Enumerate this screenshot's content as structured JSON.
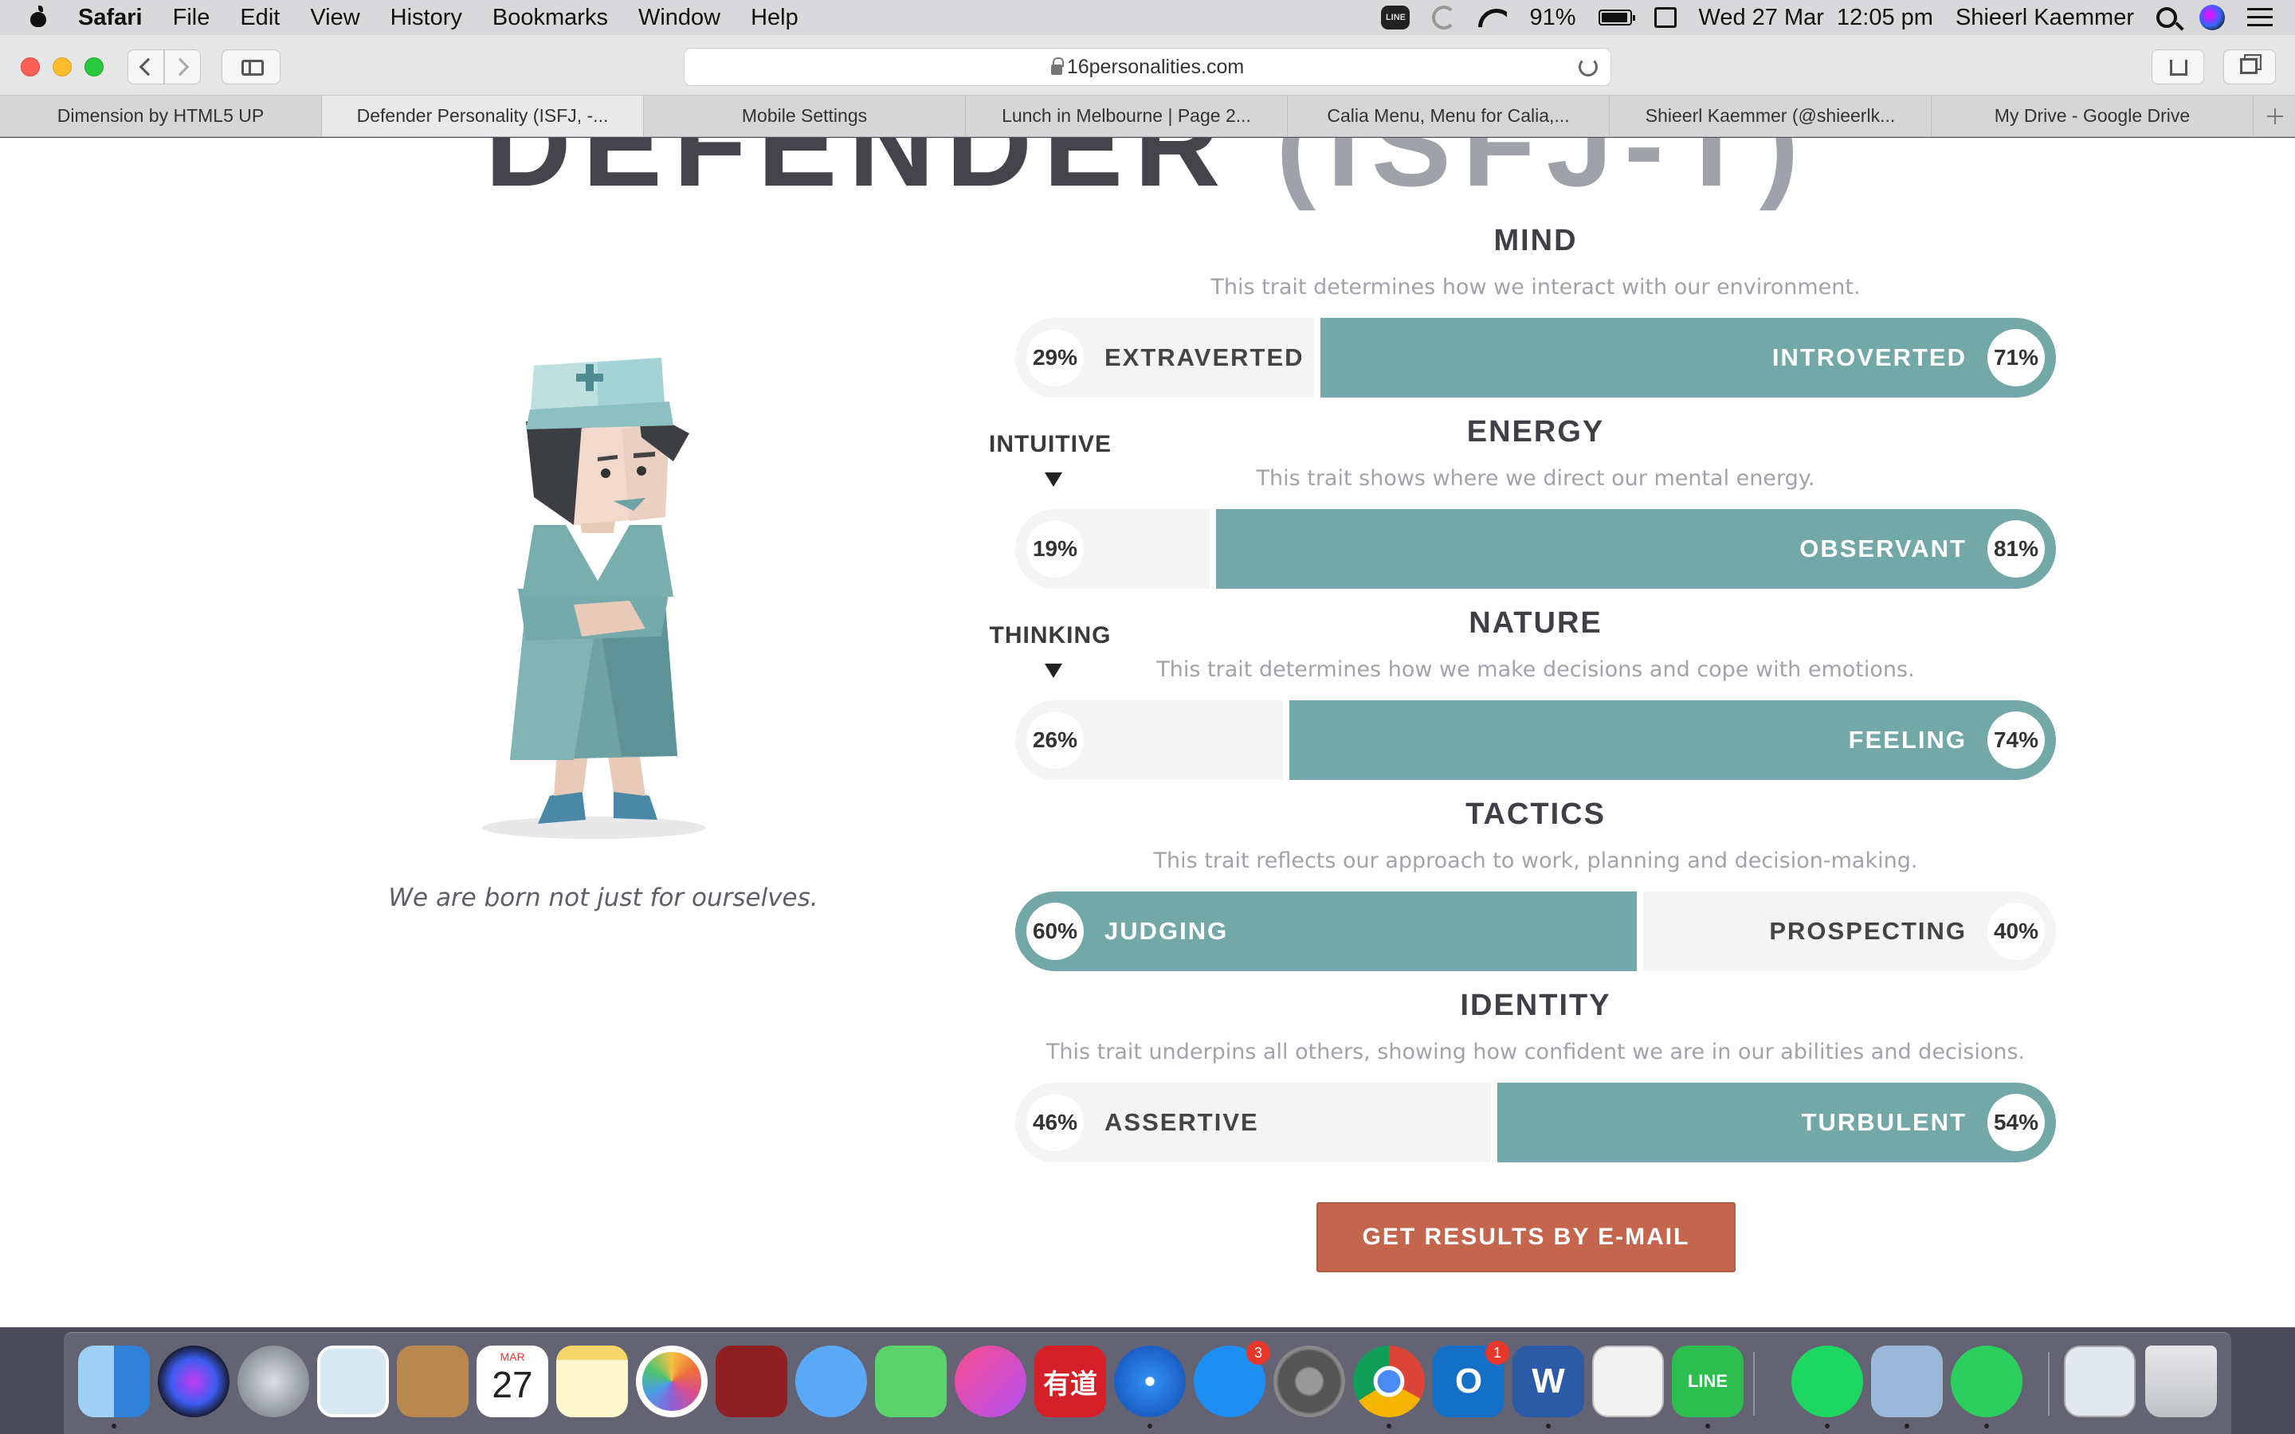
{
  "menubar": {
    "app": "Safari",
    "items": [
      "File",
      "Edit",
      "View",
      "History",
      "Bookmarks",
      "Window",
      "Help"
    ],
    "line_label": "LINE",
    "battery": "91%",
    "datetime": "Wed 27 Mar  12:05 pm",
    "user": "Shieerl Kaemmer"
  },
  "browser": {
    "url": "16personalities.com",
    "tabs": [
      "Dimension by HTML5 UP",
      "Defender Personality (ISFJ, -...",
      "Mobile Settings",
      "Lunch in Melbourne | Page 2...",
      "Calia Menu, Menu for Calia,...",
      "Shieerl Kaemmer (@shieerlk...",
      "My Drive - Google Drive"
    ],
    "active_tab": 1
  },
  "page": {
    "title": "DEFENDER",
    "code": "(ISFJ-T)",
    "quote": "We are born not just for ourselves.",
    "traits": [
      {
        "name": "MIND",
        "desc": "This trait determines how we interact with our environment.",
        "left_label": "EXTRAVERTED",
        "left_pct": "29%",
        "right_label": "INTROVERTED",
        "right_pct": "71%",
        "dominant": "right",
        "fill": 0.71
      },
      {
        "name": "ENERGY",
        "desc": "This trait shows where we direct our mental energy.",
        "left_label": "",
        "left_pct": "19%",
        "right_label": "OBSERVANT",
        "right_pct": "81%",
        "dominant": "right",
        "fill": 0.81,
        "side_note": "INTUITIVE"
      },
      {
        "name": "NATURE",
        "desc": "This trait determines how we make decisions and cope with emotions.",
        "left_label": "",
        "left_pct": "26%",
        "right_label": "FEELING",
        "right_pct": "74%",
        "dominant": "right",
        "fill": 0.74,
        "side_note": "THINKING"
      },
      {
        "name": "TACTICS",
        "desc": "This trait reflects our approach to work, planning and decision-making.",
        "left_label": "JUDGING",
        "left_pct": "60%",
        "right_label": "PROSPECTING",
        "right_pct": "40%",
        "dominant": "left",
        "fill": 0.6
      },
      {
        "name": "IDENTITY",
        "desc": "This trait underpins all others, showing how confident we are in our abilities and decisions.",
        "left_label": "ASSERTIVE",
        "left_pct": "46%",
        "right_label": "TURBULENT",
        "right_pct": "54%",
        "dominant": "right",
        "fill": 0.54
      }
    ],
    "email_button": "GET RESULTS BY E-MAIL"
  },
  "colors": {
    "accent": "#72a8a7",
    "button": "#c4654d",
    "bar_bg": "#f4f4f4"
  },
  "dock": {
    "apps": [
      "finder-icon",
      "siri-icon",
      "launchpad-icon",
      "preview-icon",
      "contacts-icon",
      "calendar-icon",
      "notes-icon",
      "photos-icon",
      "photo-booth-icon",
      "messages-icon",
      "facetime-icon",
      "itunes-icon",
      "youdao-icon",
      "safari-icon",
      "app-store-icon",
      "system-preferences-icon",
      "chrome-icon",
      "outlook-icon",
      "word-icon",
      "textedit-icon",
      "line-icon",
      "spotify-icon",
      "image-capture-icon",
      "whatsapp-icon",
      "documents-stack-icon",
      "trash-icon"
    ],
    "calendar_month": "MAR",
    "calendar_day": "27",
    "youdao_label": "有道",
    "app_store_badge": "3",
    "outlook_badge": "1",
    "outlook_letter": "O",
    "word_letter": "W",
    "line_label": "LINE"
  }
}
